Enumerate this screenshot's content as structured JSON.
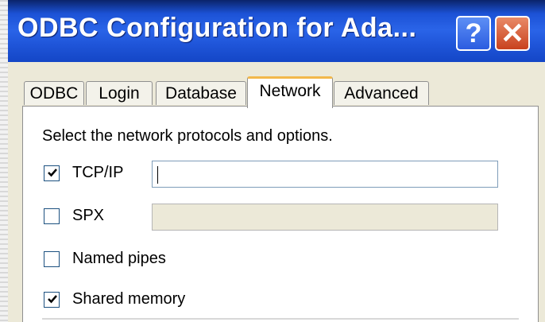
{
  "window": {
    "title": "ODBC Configuration for Ada...",
    "help_label": "?",
    "close_label": "✕"
  },
  "tabs": [
    {
      "label": "ODBC",
      "active": false
    },
    {
      "label": "Login",
      "active": false
    },
    {
      "label": "Database",
      "active": false
    },
    {
      "label": "Network",
      "active": true
    },
    {
      "label": "Advanced",
      "active": false
    }
  ],
  "network": {
    "intro": "Select the network protocols and options.",
    "options": [
      {
        "label": "TCP/IP",
        "checked": true,
        "field_value": "",
        "field_enabled": true
      },
      {
        "label": "SPX",
        "checked": false,
        "field_value": "",
        "field_enabled": false
      },
      {
        "label": "Named pipes",
        "checked": false
      },
      {
        "label": "Shared memory",
        "checked": true
      }
    ]
  },
  "colors": {
    "titlebar": "#1f55d9",
    "dialog_bg": "#ece9d8",
    "active_tab_accent": "#f2b84b",
    "close_button": "#c8421e"
  }
}
